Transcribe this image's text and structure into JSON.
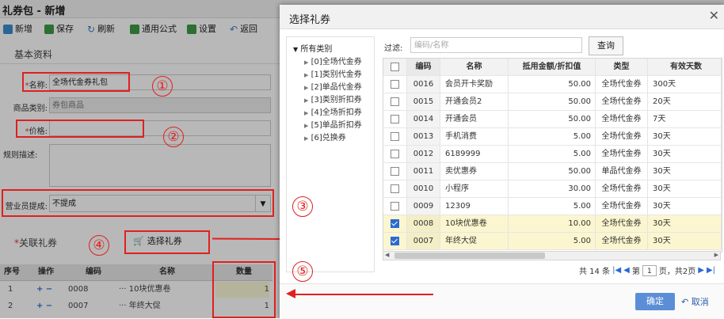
{
  "window": {
    "title": "礼券包 - 新增"
  },
  "toolbar": {
    "new": "新增",
    "save": "保存",
    "refresh": "刷新",
    "formula": "通用公式",
    "settings": "设置",
    "back": "返回"
  },
  "form": {
    "section_title": "基本资料",
    "name_label": "名称:",
    "name_value": "全场代金券礼包",
    "category_label": "商品类别:",
    "category_value": "券包商品",
    "price_label": "价格:",
    "price_value": "",
    "rules_label": "规则描述:",
    "commission_label": "营业员提成:",
    "commission_value": "不提成",
    "linked_title": "关联礼券",
    "select_btn": "选择礼券"
  },
  "linked_grid": {
    "headers": [
      "序号",
      "操作",
      "编码",
      "名称",
      "数量"
    ],
    "rows": [
      {
        "no": "1",
        "code": "0008",
        "name": "10块优惠卷",
        "qty": "1"
      },
      {
        "no": "2",
        "code": "0007",
        "name": "年终大促",
        "qty": "1"
      }
    ]
  },
  "annotations": [
    "①",
    "②",
    "③",
    "④",
    "⑤"
  ],
  "dialog": {
    "title": "选择礼券",
    "close": "✕",
    "tree_root": "所有类别",
    "tree_items": [
      "[0]全场代金券",
      "[1]类别代金券",
      "[2]单品代金券",
      "[3]类别折扣券",
      "[4]全场折扣券",
      "[5]单品折扣券",
      "[6]兑换券"
    ],
    "filter_label": "过滤:",
    "filter_placeholder": "编码/名称",
    "query_btn": "查询",
    "columns": [
      "编码",
      "名称",
      "抵用金额/折扣值",
      "类型",
      "有效天数"
    ],
    "rows": [
      {
        "code": "0016",
        "name": "会员开卡奖励",
        "value": "50.00",
        "type": "全场代金券",
        "days": "300天",
        "checked": false
      },
      {
        "code": "0015",
        "name": "开通会员2",
        "value": "50.00",
        "type": "全场代金券",
        "days": "20天",
        "checked": false
      },
      {
        "code": "0014",
        "name": "开通会员",
        "value": "50.00",
        "type": "全场代金券",
        "days": "7天",
        "checked": false
      },
      {
        "code": "0013",
        "name": "手机消费",
        "value": "5.00",
        "type": "全场代金券",
        "days": "30天",
        "checked": false
      },
      {
        "code": "0012",
        "name": "6189999",
        "value": "5.00",
        "type": "全场代金券",
        "days": "30天",
        "checked": false
      },
      {
        "code": "0011",
        "name": "卖优惠券",
        "value": "50.00",
        "type": "单品代金券",
        "days": "30天",
        "checked": false
      },
      {
        "code": "0010",
        "name": "小程序",
        "value": "30.00",
        "type": "全场代金券",
        "days": "30天",
        "checked": false
      },
      {
        "code": "0009",
        "name": "12309",
        "value": "5.00",
        "type": "全场代金券",
        "days": "30天",
        "checked": false
      },
      {
        "code": "0008",
        "name": "10块优惠卷",
        "value": "10.00",
        "type": "全场代金券",
        "days": "30天",
        "checked": true
      },
      {
        "code": "0007",
        "name": "年终大促",
        "value": "5.00",
        "type": "全场代金券",
        "days": "30天",
        "checked": true
      }
    ],
    "pager": {
      "total": "共 14 条",
      "page_prefix": "第",
      "page": "1",
      "page_suffix": "页，共2页"
    },
    "ok": "确定",
    "cancel": "取消"
  }
}
